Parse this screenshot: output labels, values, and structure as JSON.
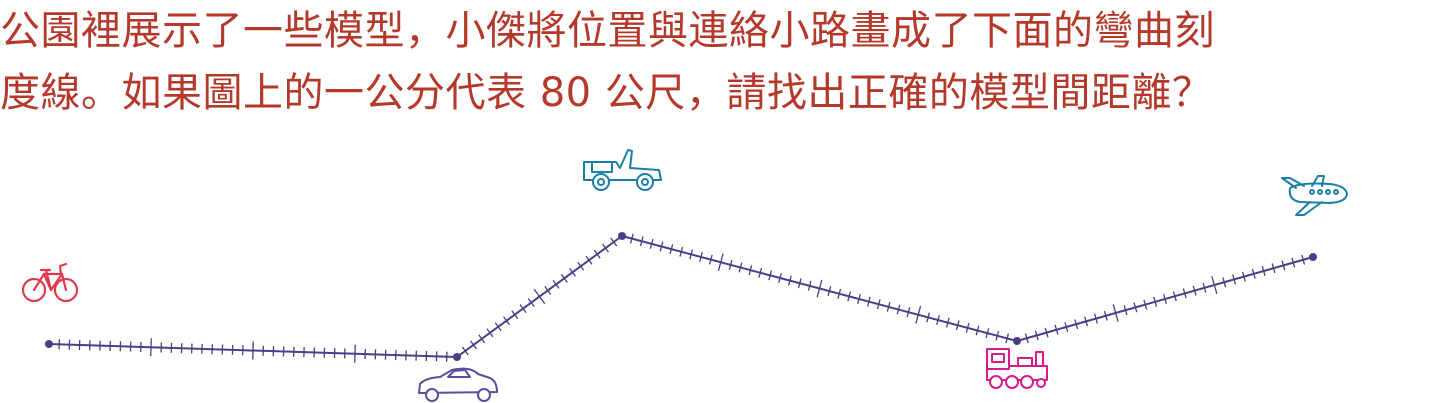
{
  "question": {
    "line1": "公園裡展示了一些模型，小傑將位置與連絡小路畫成了下面的彎曲刻",
    "line2": "度線。如果圖上的一公分代表 80 公尺，請找出正確的模型間距離？"
  },
  "colors": {
    "text": "#b5392a",
    "line": "#4a3f86",
    "bicycle": "#e03a4a",
    "car": "#5a4f9c",
    "jeep": "#1a7fa8",
    "train": "#d81b8c",
    "airplane": "#1a7fa8"
  },
  "models": [
    {
      "id": "bicycle",
      "icon": "bicycle-icon"
    },
    {
      "id": "car",
      "icon": "car-icon"
    },
    {
      "id": "jeep",
      "icon": "jeep-icon"
    },
    {
      "id": "train",
      "icon": "train-icon"
    },
    {
      "id": "airplane",
      "icon": "airplane-icon"
    }
  ]
}
